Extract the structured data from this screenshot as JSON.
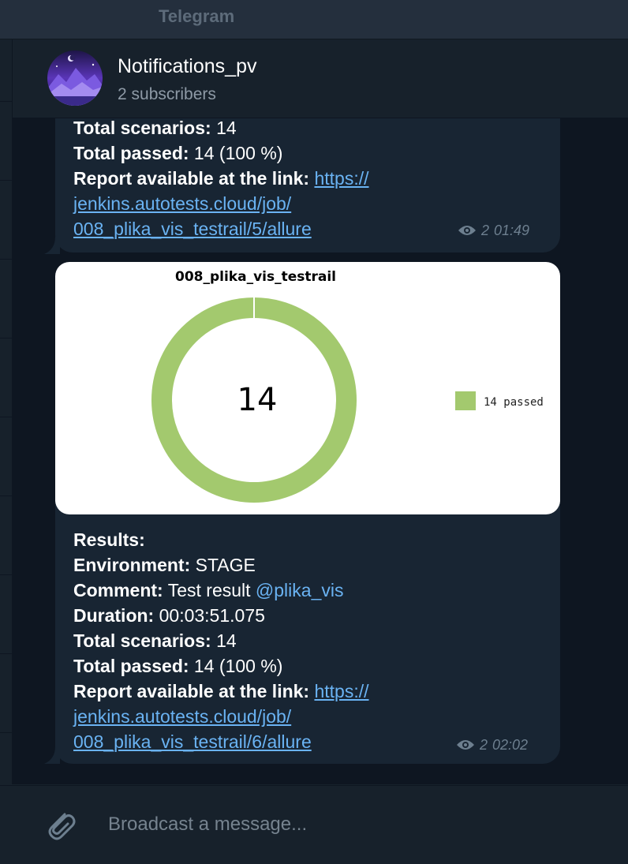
{
  "window": {
    "title": "Telegram"
  },
  "channel": {
    "name": "Notifications_pv",
    "subscribers": "2 subscribers"
  },
  "message1": {
    "lines": [
      {
        "label": "Total scenarios:",
        "value": " 14"
      },
      {
        "label": "Total passed:",
        "value": " 14 (100 %)"
      }
    ],
    "report_label": "Report available at the link: ",
    "link_line1": "https://",
    "link_line2": "jenkins.autotests.cloud/job/",
    "link_line3": "008_plika_vis_testrail/5/allure",
    "views": "2",
    "time": "01:49"
  },
  "message2": {
    "results_label": "Results:",
    "env_label": "Environment:",
    "env_value": " STAGE",
    "comment_label": "Comment:",
    "comment_value": " Test result ",
    "comment_mention": "@plika_vis",
    "duration_label": "Duration:",
    "duration_value": " 00:03:51.075",
    "scen_label": "Total scenarios:",
    "scen_value": " 14",
    "passed_label": "Total passed:",
    "passed_value": " 14 (100 %)",
    "report_label": "Report available at the link: ",
    "link_line1": "https://",
    "link_line2": "jenkins.autotests.cloud/job/",
    "link_line3": "008_plika_vis_testrail/6/allure",
    "views": "2",
    "time": "02:02"
  },
  "chart_data": {
    "type": "pie",
    "title": "008_plika_vis_testrail",
    "center_label": "14",
    "slices": [
      {
        "name": "14 passed",
        "value": 14,
        "color": "#a3c96e"
      }
    ],
    "legend": "right"
  },
  "composer": {
    "placeholder": "Broadcast a message..."
  },
  "colors": {
    "accent": "#6ab3f3",
    "bubble": "#182533",
    "background": "#0e1621",
    "passed": "#a3c96e"
  }
}
